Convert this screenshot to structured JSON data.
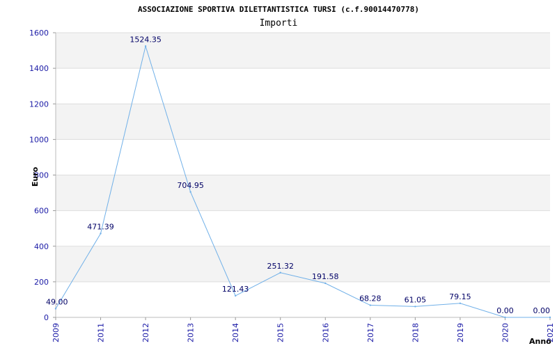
{
  "colors": {
    "line": "#70b0e8",
    "band_light": "#f3f3f3",
    "band_dark": "#ffffff",
    "grid": "#dddddd",
    "tick_text": "#1a1aa6",
    "label_text": "#000066"
  },
  "chart_data": {
    "type": "line",
    "title": "ASSOCIAZIONE SPORTIVA DILETTANTISTICA TURSI (c.f.90014470778)",
    "subtitle": "Importi",
    "xlabel": "Anno",
    "ylabel": "Euro",
    "ylim": [
      0,
      1600
    ],
    "yticks": [
      "0",
      "200",
      "400",
      "600",
      "800",
      "1000",
      "1200",
      "1400",
      "1600"
    ],
    "grid": true,
    "categories": [
      "2009",
      "2011",
      "2012",
      "2013",
      "2014",
      "2015",
      "2016",
      "2017",
      "2018",
      "2019",
      "2020",
      "2021"
    ],
    "values": [
      49.0,
      471.39,
      1524.35,
      704.95,
      121.43,
      251.32,
      191.58,
      68.28,
      61.05,
      79.15,
      0.0,
      0.0
    ],
    "labels": [
      "49.00",
      "471.39",
      "1524.35",
      "704.95",
      "121.43",
      "251.32",
      "191.58",
      "68.28",
      "61.05",
      "79.15",
      "0.00",
      "0.00"
    ],
    "series": [
      {
        "values": [
          49.0,
          471.39,
          1524.35,
          704.95,
          121.43,
          251.32,
          191.58,
          68.28,
          61.05,
          79.15,
          0.0,
          0.0
        ]
      }
    ]
  }
}
